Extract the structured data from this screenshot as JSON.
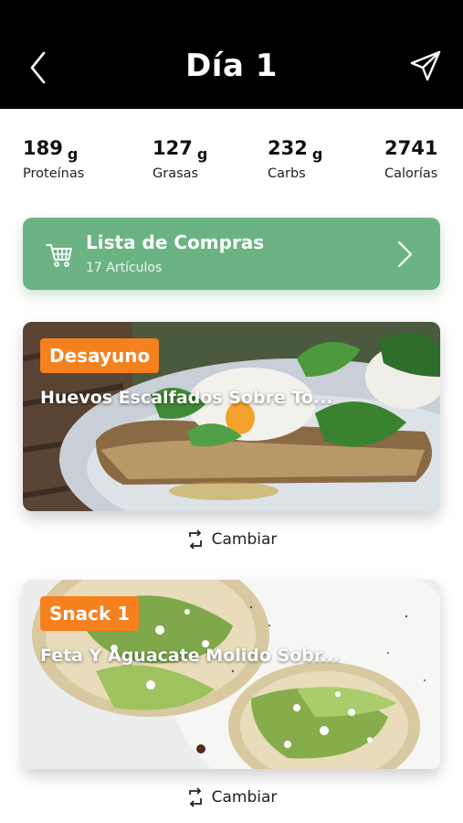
{
  "header": {
    "title": "Día 1",
    "back_icon": "chevron-left-icon",
    "share_icon": "paper-plane-icon"
  },
  "macros": [
    {
      "value": "189",
      "unit": "g",
      "label": "Proteínas"
    },
    {
      "value": "127",
      "unit": "g",
      "label": "Grasas"
    },
    {
      "value": "232",
      "unit": "g",
      "label": "Carbs"
    },
    {
      "value": "2741",
      "unit": "",
      "label": "Calorías"
    }
  ],
  "shopping": {
    "title": "Lista de Compras",
    "subtitle": "17 Artículos",
    "icon": "cart-icon",
    "color": "#6cb384"
  },
  "meals": [
    {
      "tag": "Desayuno",
      "name": "Huevos Escalfados Sobre To...",
      "swap_label": "Cambiar"
    },
    {
      "tag": "Snack 1",
      "name": "Feta Y Aguacate Molido Sobr...",
      "swap_label": "Cambiar"
    }
  ],
  "colors": {
    "accent_orange": "#f5801e",
    "header_bg": "#000000"
  }
}
